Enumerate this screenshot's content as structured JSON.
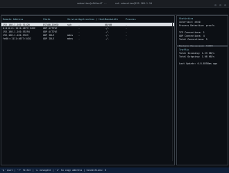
{
  "window": {
    "title_left": "sebastian@z6iHostT --",
    "title_right": "ssh sebastian@192.168.1.10"
  },
  "table": {
    "headers": [
      "Remote Address",
      "State",
      "Service",
      "Application / Host",
      "Bandwidth",
      "Process"
    ],
    "rows": [
      {
        "addr": "192.168.1.101:51420",
        "state": "ESTABLISHED",
        "svc": "ssh",
        "app": "-",
        "bw": "0B/0B",
        "proc": "-",
        "selected": true
      },
      {
        "addr": "0:0:0:0::1111:4677:5432",
        "state": "UDP ACTIVE",
        "svc": "",
        "app": "-",
        "bw": "-/-",
        "proc": "-",
        "selected": false
      },
      {
        "addr": "192.168.1.101:55294",
        "state": "UDP ACTIVE",
        "svc": "",
        "app": "-",
        "bw": "-/-",
        "proc": "-",
        "selected": false
      },
      {
        "addr": "192.168.1.101:5353",
        "state": "UDP IDLE",
        "svc": "mdns",
        "app": "-",
        "bw": "-/-",
        "proc": "-",
        "selected": false
      },
      {
        "addr": "fe80::1111:4677:5432",
        "state": "UDP IDLE",
        "svc": "mdns",
        "app": "-",
        "bw": "-/-",
        "proc": "-",
        "selected": false
      }
    ]
  },
  "stats": {
    "title": "Statistics",
    "interface": "Interface: eth0",
    "detection": "Process Detection: procfs",
    "tcp": "TCP Connections: 1",
    "udp": "UDP Connections: 4",
    "total": "Total Connections: 5",
    "packets": "Packets Processed: 10882"
  },
  "traffic": {
    "title": "Traffic",
    "incoming": "Total Incoming: 1.23 KB/s",
    "outgoing": "Total Outgoing: 1.08 KB/s",
    "update": "Last Update: 0.8-8558ms ago"
  },
  "status": {
    "text": "'q' quit | 'f' filter | ↑↓ navigate | 'c' to copy address | Connections: 5"
  }
}
